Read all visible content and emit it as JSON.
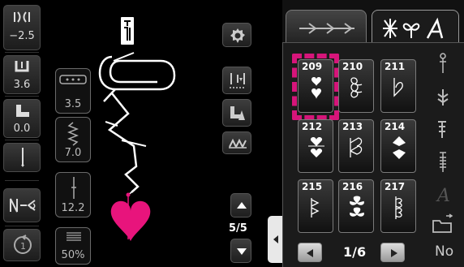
{
  "left_column": {
    "stitch_width": "−2.5",
    "stitch_length": "3.6",
    "presser_pressure": "0.0"
  },
  "stitch_params": {
    "width": "3.5",
    "length": "7.0",
    "tension": "12.2",
    "density": "50%"
  },
  "page": {
    "counter": "5/5",
    "grid_page": "1/6"
  },
  "stitches": [
    {
      "num": "209",
      "icon": "heart-stack-icon"
    },
    {
      "num": "210",
      "icon": "outline-hearts-icon"
    },
    {
      "num": "211",
      "icon": "single-outline-heart-icon"
    },
    {
      "num": "212",
      "icon": "heart-pair-icon"
    },
    {
      "num": "213",
      "icon": "outline-heart-pair-icon"
    },
    {
      "num": "214",
      "icon": "diamond-hearts-icon"
    },
    {
      "num": "215",
      "icon": "outline-chain-icon"
    },
    {
      "num": "216",
      "icon": "clover-stack-icon"
    },
    {
      "num": "217",
      "icon": "outline-clover-icon"
    }
  ],
  "side_labels": {
    "no": "No"
  },
  "colors": {
    "accent_pink": "#e8147c",
    "selection_pink": "#d6157a",
    "panel_bg": "#1b1b1b"
  }
}
